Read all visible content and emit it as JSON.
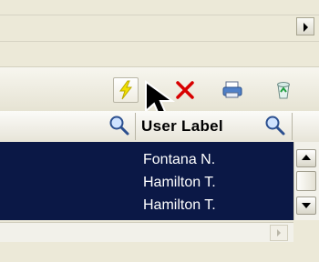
{
  "table": {
    "column_header": "User Label",
    "rows": [
      "Fontana N.",
      "Hamilton T.",
      "Hamilton T."
    ]
  },
  "toolbar": {
    "buttons": [
      {
        "icon": "lightning-icon"
      },
      {
        "icon": "delete-x-icon"
      },
      {
        "icon": "printer-icon"
      },
      {
        "icon": "recycle-bin-icon"
      }
    ]
  },
  "colors": {
    "list_background": "#0b1846",
    "lightning": "#f2e000",
    "delete": "#d80000"
  }
}
